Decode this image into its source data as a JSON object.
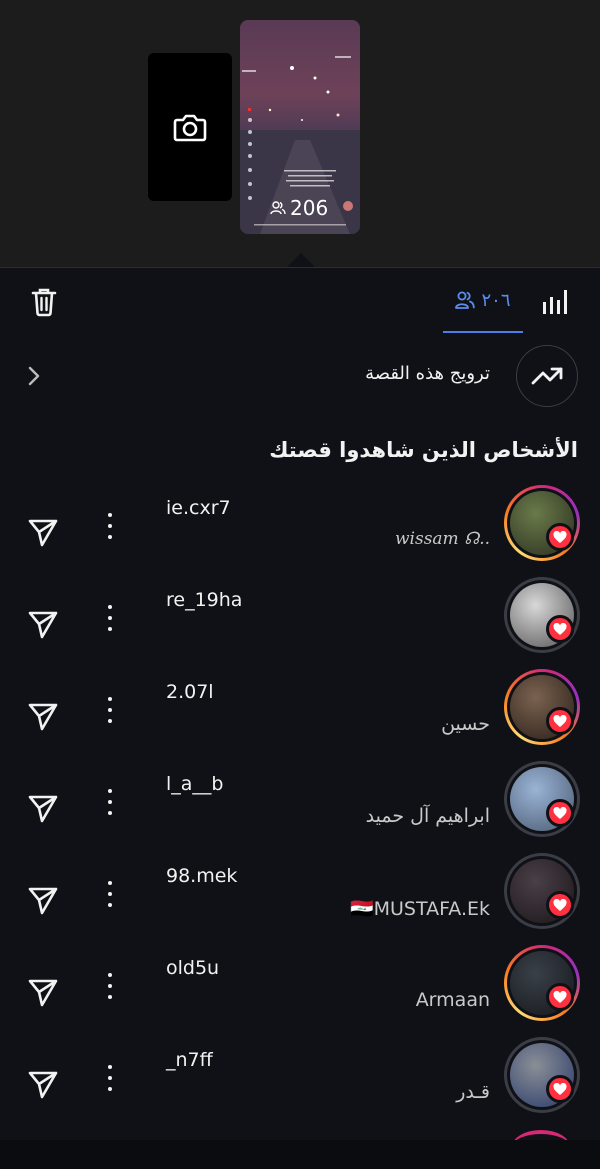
{
  "story_preview": {
    "view_count": "206"
  },
  "toolbar": {
    "viewers_count": "٢٠٦"
  },
  "promote": {
    "label": "ترويج هذه القصة"
  },
  "section_title": "الأشخاص الذين شاهدوا قصتك",
  "viewers": [
    {
      "username": "ie.cxr7",
      "fullname": "..☊ wissam",
      "ring": "gradient",
      "avatar_colors": [
        "#6a7a4a",
        "#2a2f1f"
      ]
    },
    {
      "username": "re_19ha",
      "fullname": "",
      "ring": "grey",
      "avatar_colors": [
        "#d8d8d8",
        "#555555"
      ]
    },
    {
      "username": "2.07l",
      "fullname": "حسين",
      "ring": "gradient",
      "avatar_colors": [
        "#7a6250",
        "#2a1f18"
      ]
    },
    {
      "username": "l_a__b",
      "fullname": "ابراهيم آل حميد",
      "ring": "grey",
      "avatar_colors": [
        "#9ab4d6",
        "#4a5a70"
      ]
    },
    {
      "username": "98.mek",
      "fullname": "🇮🇶MUSTAFA.Ek",
      "ring": "grey",
      "avatar_colors": [
        "#4a4048",
        "#1a1518"
      ]
    },
    {
      "username": "old5u",
      "fullname": "Armaan",
      "ring": "gradient",
      "avatar_colors": [
        "#3a4048",
        "#15181c"
      ]
    },
    {
      "username": "_n7ff",
      "fullname": "قـدر",
      "ring": "grey",
      "avatar_colors": [
        "#8a8f96",
        "#2a3a6a"
      ]
    }
  ],
  "colors": {
    "accent": "#4c7ee8",
    "heart": "#ff3040",
    "background": "#0f1116"
  },
  "icons": [
    "camera-icon",
    "trash-icon",
    "viewers-icon",
    "insights-icon",
    "chevron-left-icon",
    "trending-up-icon",
    "send-icon",
    "more-vertical-icon",
    "heart-icon"
  ]
}
